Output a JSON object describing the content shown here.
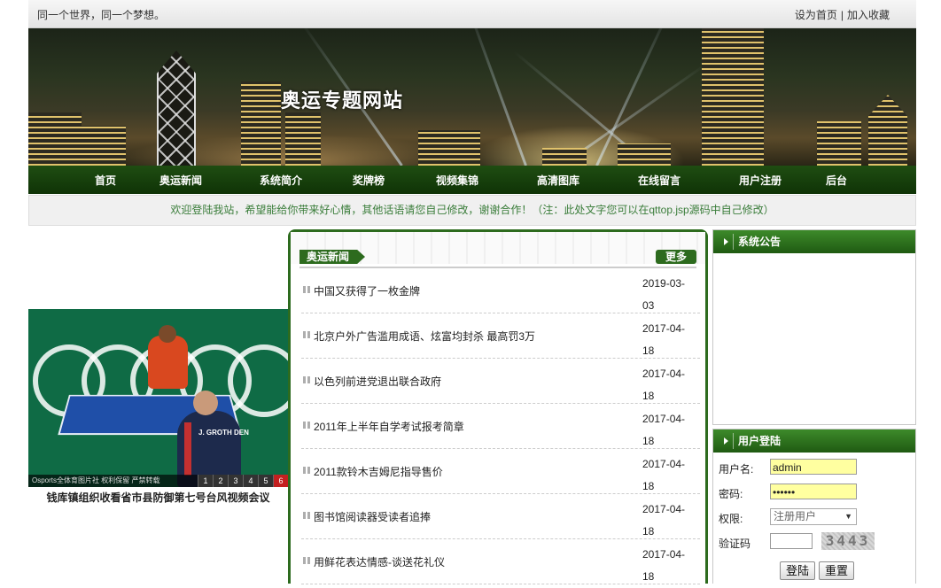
{
  "topbar": {
    "slogan": "同一个世界，同一个梦想。",
    "set_home": "设为首页",
    "separator": "|",
    "add_favorite": "加入收藏"
  },
  "banner": {
    "title": "奥运专题网站"
  },
  "nav": {
    "items": [
      "首页",
      "奥运新闻",
      "系统简介",
      "奖牌榜",
      "视频集锦",
      "高清图库",
      "在线留言",
      "用户注册",
      "后台"
    ]
  },
  "welcome": {
    "text": "欢迎登陆我站，希望能给你带来好心情，其他话语请您自己修改，谢谢合作！（注：此处文字您可以在qttop.jsp源码中自己修改）"
  },
  "slideshow": {
    "player_name": "J. GROTH DEN",
    "overlay_text": "Osports全体育图片社 权利保留 严禁转载",
    "pages": [
      "1",
      "2",
      "3",
      "4",
      "5",
      "6"
    ],
    "active_page": "6",
    "caption": "钱库镇组织收看省市县防御第七号台风视频会议"
  },
  "news": {
    "title": "奥运新闻",
    "more": "更多",
    "items": [
      {
        "title": "中国又获得了一枚金牌",
        "date": "2019-03-03"
      },
      {
        "title": "北京户外广告滥用成语、炫富均封杀 最高罚3万",
        "date": "2017-04-18"
      },
      {
        "title": "以色列前进党退出联合政府",
        "date": "2017-04-18"
      },
      {
        "title": "2011年上半年自学考试报考简章",
        "date": "2017-04-18"
      },
      {
        "title": "2011款铃木吉姆尼指导售价",
        "date": "2017-04-18"
      },
      {
        "title": "图书馆阅读器受读者追捧",
        "date": "2017-04-18"
      },
      {
        "title": "用鲜花表达情感-谈送花礼仪",
        "date": "2017-04-18"
      }
    ]
  },
  "announcement": {
    "title": "系统公告"
  },
  "login": {
    "title": "用户登陆",
    "username_label": "用户名:",
    "username_value": "admin",
    "password_label": "密码:",
    "password_value": "••••••",
    "role_label": "权限:",
    "role_value": "注册用户",
    "captcha_label": "验证码",
    "captcha_value": "3443",
    "login_button": "登陆",
    "reset_button": "重置"
  },
  "colors": {
    "nav_green": "#1f4d12",
    "accent_green": "#2d6b1e",
    "welcome_text": "#3a7d3a",
    "input_yellow": "#ffffa0",
    "active_page_red": "#c42020"
  }
}
